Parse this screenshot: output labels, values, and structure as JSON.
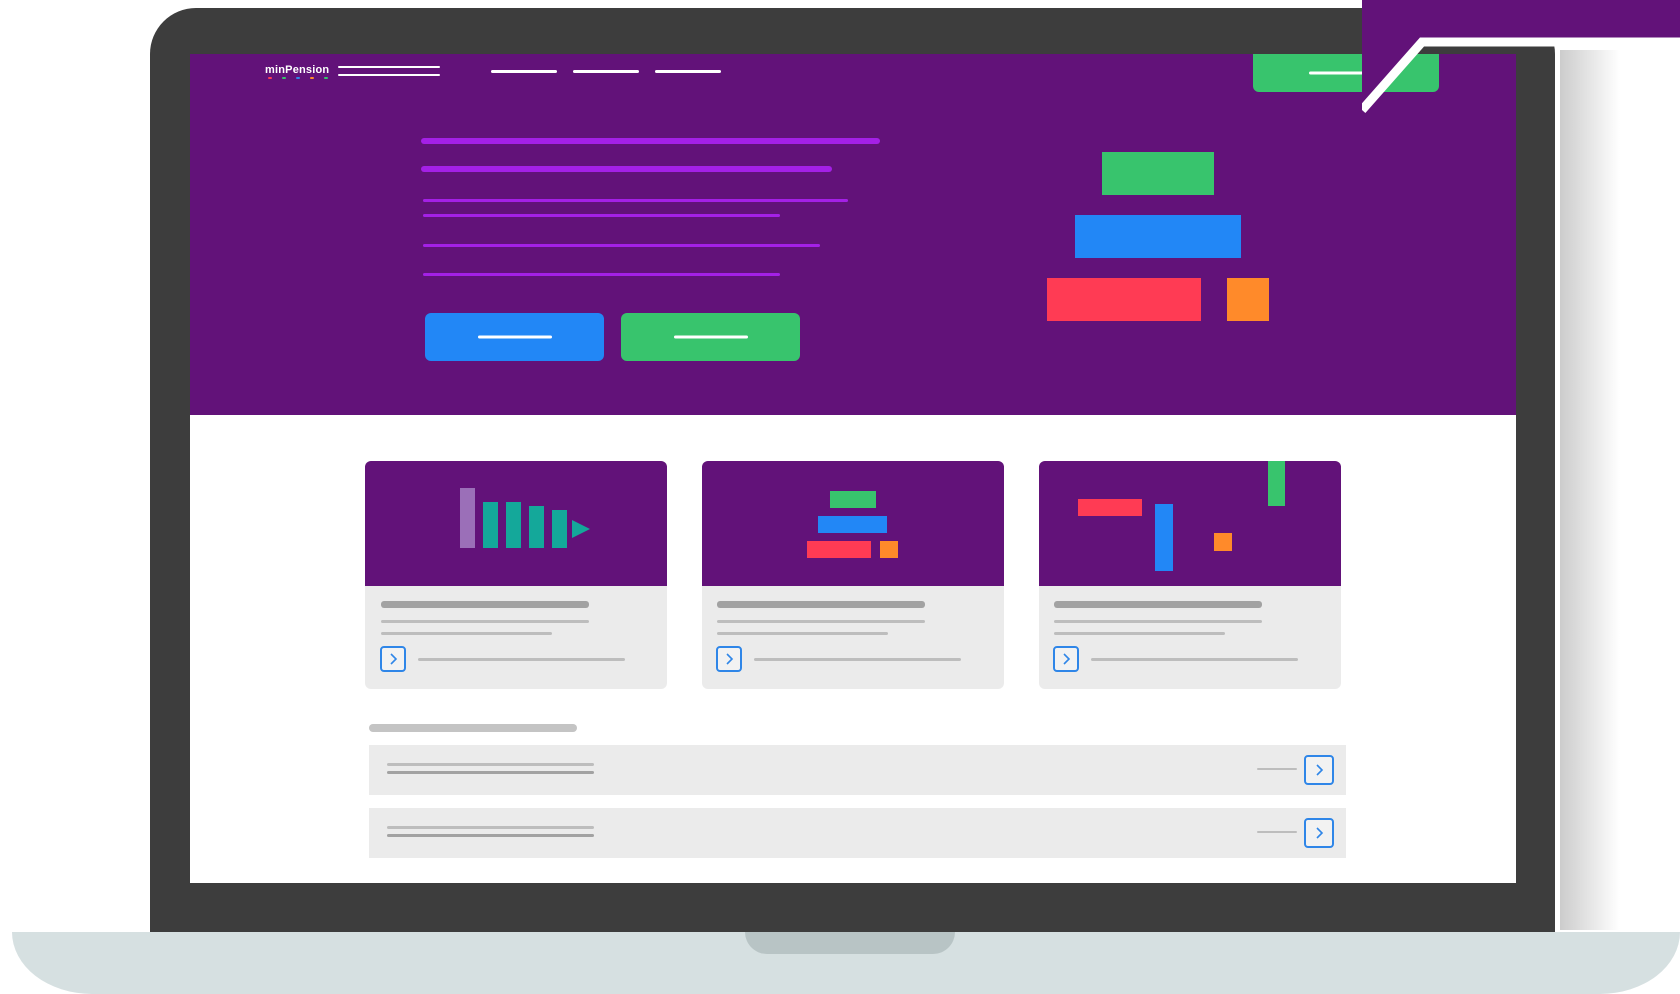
{
  "brand": {
    "name": "minPension",
    "accent": "#621279",
    "logo_dot_colors": [
      "#ff3b54",
      "#38c46d",
      "#2f86e8",
      "#ff8a2a",
      "#38c46d"
    ]
  },
  "colors": {
    "hero_background": "#621279",
    "hero_text_lines": "#a420e6",
    "primary_button": "#2287f6",
    "secondary_button": "#38c46d",
    "card_background": "#ebebeb",
    "arrow_icon": "#2f86e8",
    "laptop_frame": "#3d3d3d",
    "laptop_base": "#d6e0e1"
  },
  "icons": {
    "card_arrow": "chevron-right-icon",
    "row_arrow": "chevron-right-icon"
  }
}
